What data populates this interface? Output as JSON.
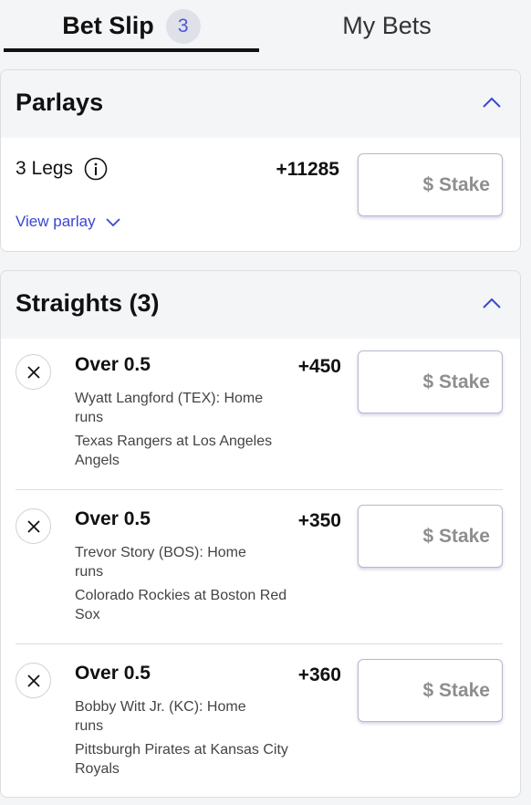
{
  "tabs": {
    "bet_slip_label": "Bet Slip",
    "bet_slip_count": "3",
    "my_bets_label": "My Bets"
  },
  "parlays": {
    "title": "Parlays",
    "legs_label": "3 Legs",
    "odds": "+11285",
    "view_parlay_label": "View parlay",
    "stake_placeholder": "$ Stake"
  },
  "straights": {
    "title": "Straights (3)",
    "items": [
      {
        "selection": "Over 0.5",
        "odds": "+450",
        "market": "Wyatt Langford (TEX): Home runs",
        "event": "Texas Rangers at Los Angeles Angels",
        "stake_placeholder": "$ Stake"
      },
      {
        "selection": "Over 0.5",
        "odds": "+350",
        "market": "Trevor Story (BOS): Home runs",
        "event": "Colorado Rockies at Boston Red Sox",
        "stake_placeholder": "$ Stake"
      },
      {
        "selection": "Over 0.5",
        "odds": "+360",
        "market": "Bobby Witt Jr. (KC): Home runs",
        "event": "Pittsburgh Pirates at Kansas City Royals",
        "stake_placeholder": "$ Stake"
      }
    ]
  },
  "colors": {
    "accent": "#3b46d0",
    "badge_bg": "#dfe1e8",
    "header_bg": "#f4f5f7"
  },
  "icons": {
    "collapse": "chevron-up-icon",
    "expand": "chevron-down-icon",
    "info": "info-icon",
    "remove": "close-icon"
  }
}
